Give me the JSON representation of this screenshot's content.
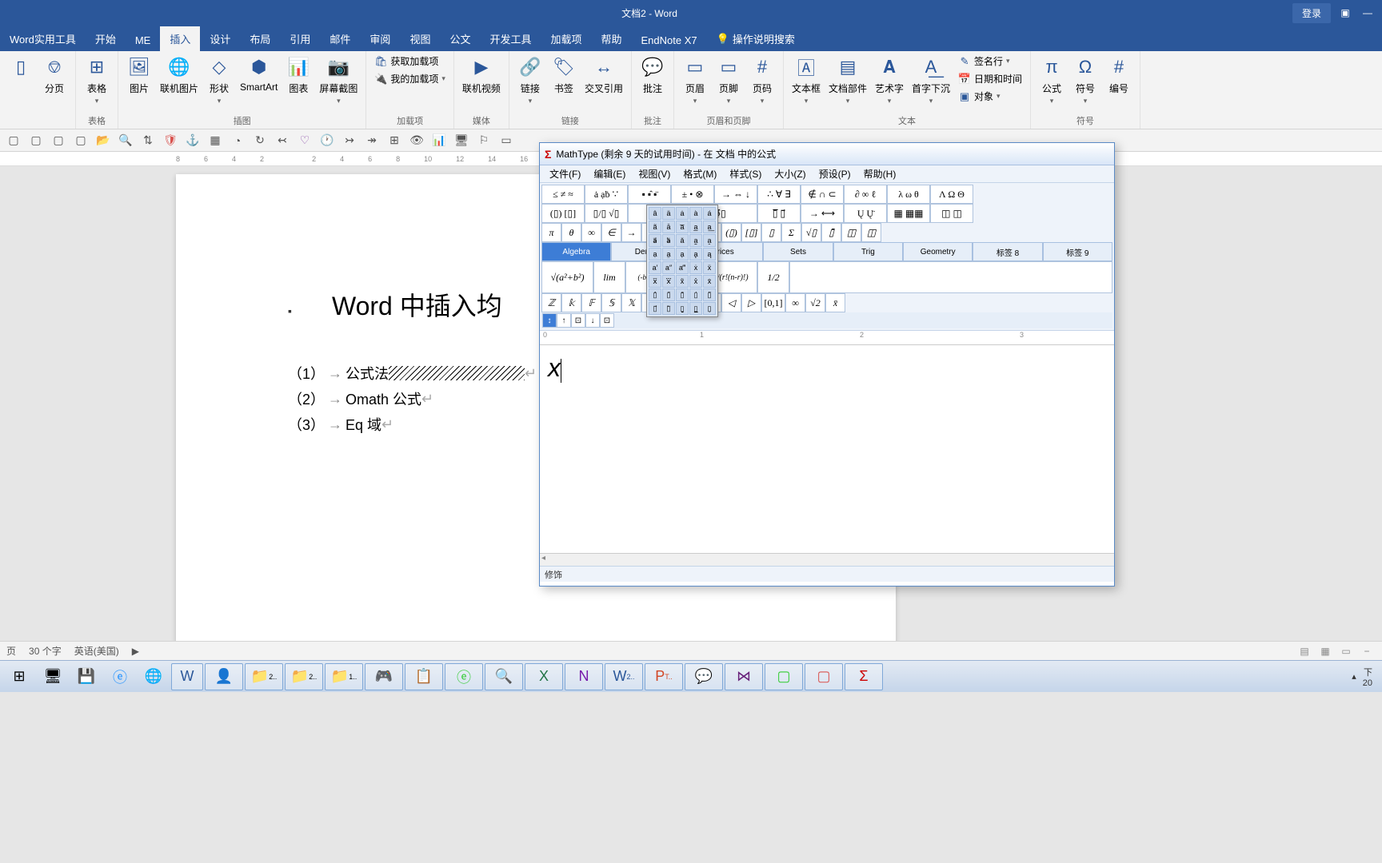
{
  "titlebar": {
    "doc_title": "文档2 - Word",
    "login": "登录"
  },
  "tabs": {
    "addin": "Word实用工具",
    "home": "开始",
    "me": "ME",
    "insert": "插入",
    "design": "设计",
    "layout": "布局",
    "references": "引用",
    "mailings": "邮件",
    "review": "审阅",
    "view": "视图",
    "gongwen": "公文",
    "developer": "开发工具",
    "addins": "加载项",
    "help": "帮助",
    "endnote": "EndNote X7",
    "tell_me": "操作说明搜索"
  },
  "ribbon": {
    "pages": {
      "break": "分页",
      "group": ""
    },
    "tables": {
      "table": "表格",
      "group": "表格"
    },
    "illustrations": {
      "picture": "图片",
      "online_pic": "联机图片",
      "shapes": "形状",
      "smartart": "SmartArt",
      "chart": "图表",
      "screenshot": "屏幕截图",
      "group": "插图"
    },
    "addins": {
      "get": "获取加载项",
      "my": "我的加载项",
      "group": "加载项"
    },
    "media": {
      "video": "联机视频",
      "group": "媒体"
    },
    "links": {
      "link": "链接",
      "bookmark": "书签",
      "crossref": "交叉引用",
      "group": "链接"
    },
    "comments": {
      "comment": "批注",
      "group": "批注"
    },
    "headerfooter": {
      "header": "页眉",
      "footer": "页脚",
      "pagenum": "页码",
      "group": "页眉和页脚"
    },
    "text": {
      "textbox": "文本框",
      "quickparts": "文档部件",
      "wordart": "艺术字",
      "dropcap": "首字下沉",
      "signature": "签名行",
      "datetime": "日期和时间",
      "object": "对象",
      "group": "文本"
    },
    "symbols": {
      "equation": "公式",
      "symbol": "符号",
      "number": "编号",
      "group": "符号"
    }
  },
  "document": {
    "title_partial": "Word 中插入均",
    "item1_num": "（1）",
    "item1_text": "公式法",
    "item2_num": "（2）",
    "item2_text": "Omath 公式",
    "item3_num": "（3）",
    "item3_text": "Eq 域"
  },
  "mathtype": {
    "title": "MathType (剩余 9 天的试用时间) - 在 文档 中的公式",
    "menu": {
      "file": "文件(F)",
      "edit": "编辑(E)",
      "view": "视图(V)",
      "format": "格式(M)",
      "style": "样式(S)",
      "size": "大小(Z)",
      "preset": "预设(P)",
      "help": "帮助(H)"
    },
    "row1": [
      "≤ ≠ ≈",
      "ȧ ạḃ ∵",
      "▪ ▪̂ ▪̈",
      "± • ⊗",
      "→ ⇔ ↓",
      "∴ ∀ ∃",
      "∉ ∩ ⊂",
      "∂ ∞ ℓ",
      "λ ω θ",
      "Λ Ω Θ"
    ],
    "row2": [
      "(▯) [▯]",
      "▯/▯ √▯",
      "▯̄",
      "Σ▯ ∮▯",
      "▯̅ ▯⃗",
      "→ ⟷",
      "Ų Ų̈",
      "▦ ▦▦",
      "◫ ◫"
    ],
    "row3": [
      "π",
      "θ",
      "∞",
      "∈",
      "→",
      "±",
      "(▯)",
      "[▯]",
      "▯",
      "Σ",
      "√▯",
      "▯̄",
      "◫",
      "◫"
    ],
    "tabs": [
      "Algebra",
      "Derivs",
      "atrices",
      "Sets",
      "Trig",
      "Geometry",
      "标签 8",
      "标签 9"
    ],
    "formulas": [
      "√(a²+b²)",
      "lim",
      "(-b±√(b²-4ac))/2a",
      "n!/(r!(n-r)!)",
      "1/2"
    ],
    "syms": [
      "ℤ",
      "𝕜",
      "𝔽",
      "𝕊",
      "𝕏",
      "⊕",
      "◁",
      "▷",
      "[0,1]",
      "∞",
      "√2",
      "x̄"
    ],
    "canvas_content": "x",
    "status": "修饰"
  },
  "statusbar": {
    "page": "页",
    "words": "30 个字",
    "lang": "英语(美国)"
  },
  "taskbar": {
    "time_suffix": "下",
    "date_suffix": "20"
  }
}
